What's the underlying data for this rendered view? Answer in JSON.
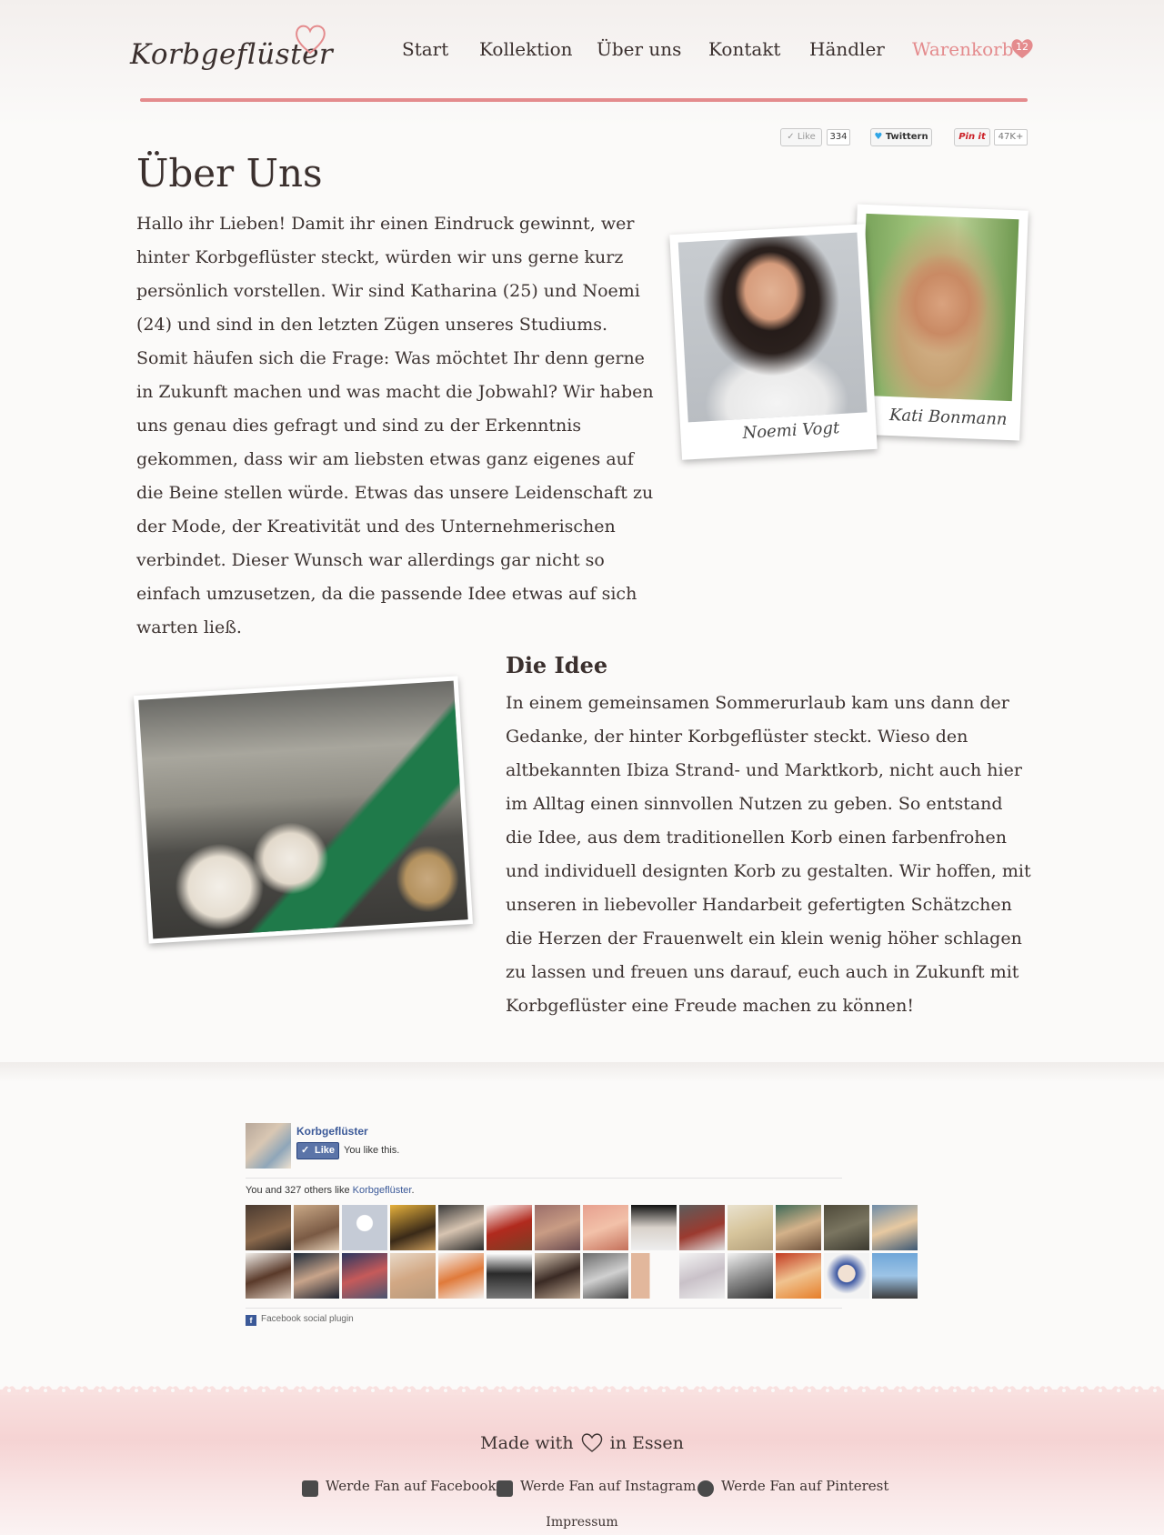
{
  "header": {
    "logo": "Korbgeflüster",
    "nav": [
      {
        "label": "Start"
      },
      {
        "label": "Kollektion"
      },
      {
        "label": "Über uns"
      },
      {
        "label": "Kontakt"
      },
      {
        "label": "Händler"
      },
      {
        "label": "Warenkorb"
      }
    ],
    "cart_count": "12"
  },
  "share": {
    "fb_like_label": "Like",
    "fb_like_count": "334",
    "twitter_label": "Twittern",
    "pinit_label": "Pin it",
    "pinit_count": "47K+"
  },
  "colors": {
    "accent": "#e48b8d",
    "text": "#3d3331",
    "facebook": "#3b5998"
  },
  "main": {
    "title": "Über Uns",
    "intro": "Hallo ihr Lieben! Damit ihr einen Eindruck gewinnt, wer hinter Korbgeflüster steckt, würden wir uns gerne kurz persönlich vorstellen. Wir sind Katharina (25) und Noemi (24) und sind in den letzten Zügen unseres Studiums. Somit häufen sich die Frage: Was möchtet Ihr denn gerne in Zukunft machen und was macht die Jobwahl? Wir haben uns genau dies gefragt und sind zu der Erkenntnis gekommen, dass wir am liebsten etwas ganz eigenes auf die Beine stellen würde. Etwas das unsere Leidenschaft zu der Mode, der Kreativität und des Unternehmerischen verbindet. Dieser Wunsch war allerdings gar nicht so einfach umzusetzen, da die passende Idee etwas auf sich warten ließ.",
    "photos": [
      {
        "caption": "Noemi Vogt"
      },
      {
        "caption": "Kati Bonmann"
      }
    ],
    "idea": {
      "title": "Die Idee",
      "text": "In einem gemeinsamen Sommerurlaub kam uns dann der Gedanke, der hinter Korbgeflüster steckt. Wieso den altbekannten Ibiza Strand- und Marktkorb, nicht auch hier im Alltag einen sinnvollen Nutzen zu geben. So entstand die Idee, aus dem traditionellen Korb einen farbenfrohen und individuell designten Korb zu gestalten. Wir hoffen, mit unseren in liebevoller Handarbeit gefertigten Schätzchen die Herzen der Frauenwelt ein klein wenig höher schlagen zu lassen und freuen uns darauf, euch auch in Zukunft mit Korbgeflüster eine Freude machen zu können!"
    }
  },
  "facebook": {
    "page_name": "Korbgeflüster",
    "like_button": "Like",
    "you_like": "You like this.",
    "others_prefix": "You and 327 others like ",
    "others_link": "Korbgeflüster",
    "others_suffix": ".",
    "plugin_label": "Facebook social plugin"
  },
  "footer": {
    "made_with_prefix": "Made with",
    "made_with_suffix": "in Essen",
    "links": [
      {
        "label": "Werde Fan auf Facebook",
        "icon": "facebook-icon"
      },
      {
        "label": "Werde Fan auf Instagram",
        "icon": "instagram-icon"
      },
      {
        "label": "Werde Fan auf Pinterest",
        "icon": "pinterest-icon"
      }
    ],
    "impressum": "Impressum"
  }
}
